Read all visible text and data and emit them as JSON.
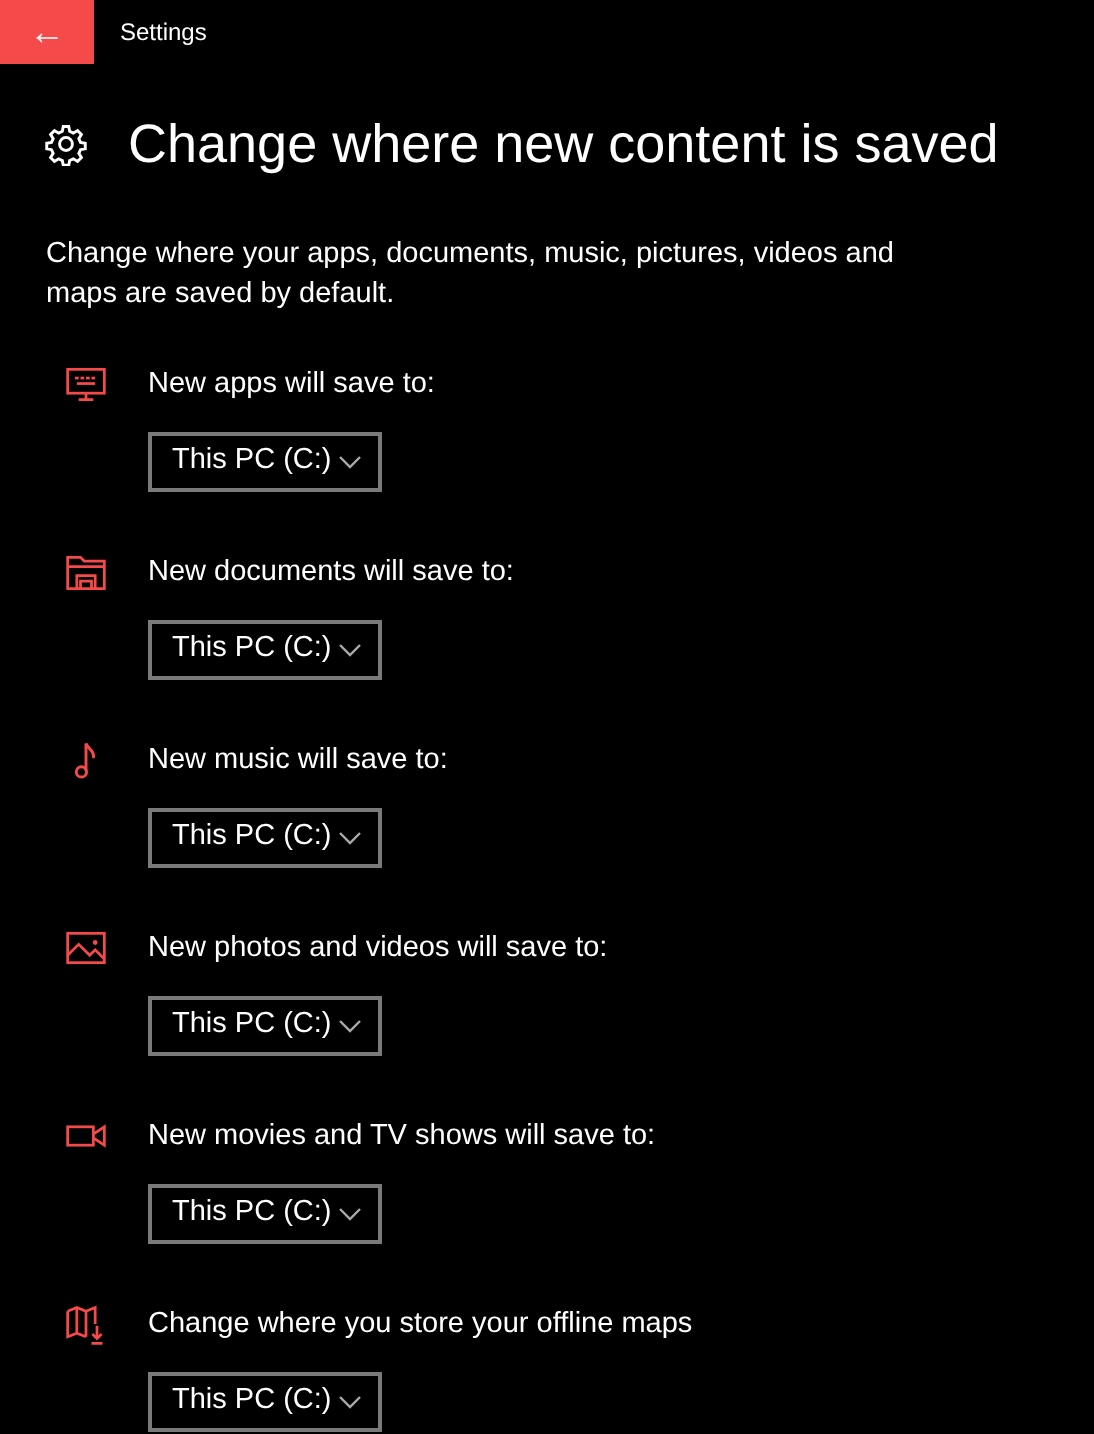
{
  "window": {
    "title": "Settings",
    "back": "←"
  },
  "page": {
    "title": "Change where new content is saved",
    "description": "Change where your apps, documents, music, pictures, videos and maps are saved by default."
  },
  "sections": [
    {
      "kind": "apps",
      "label": "New apps will save to:",
      "value": "This PC (C:)"
    },
    {
      "kind": "documents",
      "label": "New documents will save to:",
      "value": "This PC (C:)"
    },
    {
      "kind": "music",
      "label": "New music will save to:",
      "value": "This PC (C:)"
    },
    {
      "kind": "photos",
      "label": "New photos and videos will save to:",
      "value": "This PC (C:)"
    },
    {
      "kind": "movies",
      "label": "New movies and TV shows will save to:",
      "value": "This PC (C:)"
    },
    {
      "kind": "maps",
      "label": "Change where you store your offline maps",
      "value": "This PC (C:)"
    }
  ]
}
